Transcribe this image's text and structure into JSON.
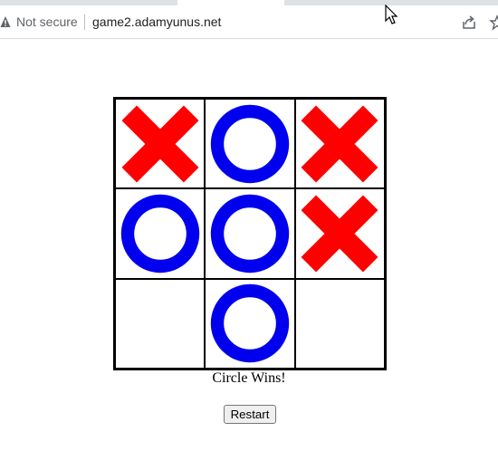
{
  "browser": {
    "security_label": "Not secure",
    "url": "game2.adamyunus.net",
    "icons": [
      "warning-icon",
      "share-icon",
      "bookmark-star-icon",
      "mouse-cursor-icon"
    ]
  },
  "game": {
    "board": [
      [
        "X",
        "O",
        "X"
      ],
      [
        "O",
        "O",
        "X"
      ],
      [
        "",
        "O",
        ""
      ]
    ],
    "status": "Circle Wins!",
    "restart_label": "Restart",
    "colors": {
      "x": "#ff0000",
      "o": "#0000ee"
    }
  }
}
